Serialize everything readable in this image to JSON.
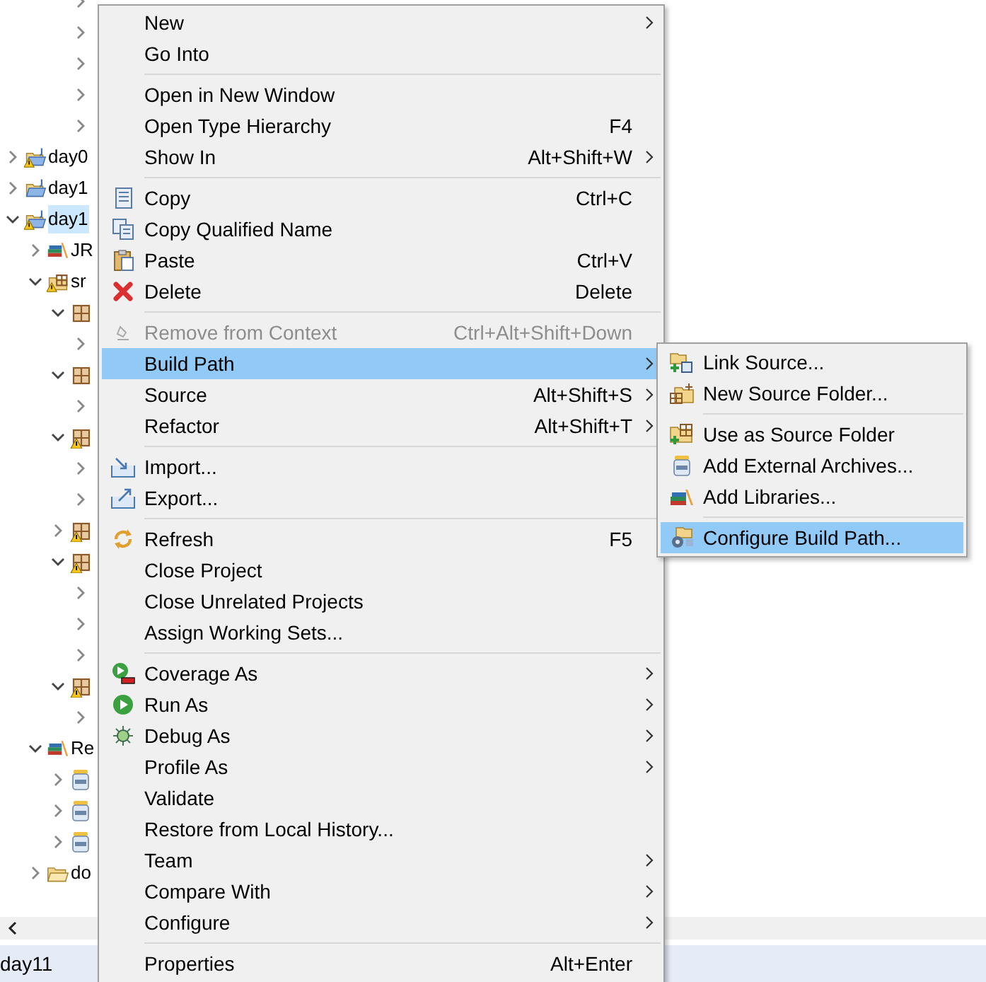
{
  "tree": {
    "items": [
      {
        "children": [
          {
            "children": [
              {
                "children": [
                  {
                    "kind": "file",
                    "expanded": false
                  },
                  {
                    "kind": "file",
                    "expanded": false
                  },
                  {
                    "kind": "file",
                    "expanded": false
                  },
                  {
                    "kind": "file",
                    "expanded": false
                  },
                  {
                    "kind": "file",
                    "expanded": false
                  }
                ]
              }
            ]
          }
        ]
      },
      {
        "kind": "project",
        "label": "day0",
        "expanded": false,
        "warning": true,
        "selected": false
      },
      {
        "kind": "project",
        "label": "day1",
        "expanded": false,
        "warning": false,
        "selected": false
      },
      {
        "kind": "project",
        "label": "day1",
        "expanded": true,
        "warning": true,
        "selected": true,
        "children": [
          {
            "kind": "library",
            "label": "JR",
            "expanded": false,
            "selected": false
          },
          {
            "kind": "source-folder",
            "label": "sr",
            "expanded": true,
            "warning": true,
            "selected": false,
            "children": [
              {
                "kind": "package",
                "expanded": true,
                "warning": false,
                "children": [
                  {
                    "kind": "file",
                    "expanded": false
                  }
                ]
              },
              {
                "kind": "package",
                "expanded": true,
                "warning": false,
                "children": [
                  {
                    "kind": "file",
                    "expanded": false
                  }
                ]
              },
              {
                "kind": "package",
                "expanded": true,
                "warning": true,
                "children": [
                  {
                    "kind": "file",
                    "expanded": false
                  },
                  {
                    "kind": "file",
                    "expanded": false
                  }
                ]
              },
              {
                "kind": "package",
                "expanded": false,
                "warning": true
              },
              {
                "kind": "package",
                "expanded": true,
                "warning": true,
                "children": [
                  {
                    "kind": "file",
                    "expanded": false
                  },
                  {
                    "kind": "file",
                    "expanded": false
                  },
                  {
                    "kind": "file",
                    "expanded": false
                  }
                ]
              },
              {
                "kind": "package",
                "expanded": true,
                "warning": true,
                "children": [
                  {
                    "kind": "file",
                    "expanded": false
                  }
                ]
              }
            ]
          },
          {
            "kind": "library",
            "label": "Re",
            "expanded": true,
            "selected": false,
            "children": [
              {
                "kind": "jar",
                "expanded": false
              },
              {
                "kind": "jar",
                "expanded": false
              },
              {
                "kind": "jar",
                "expanded": false
              }
            ]
          },
          {
            "kind": "folder",
            "label": "do",
            "expanded": false,
            "selected": false
          }
        ]
      }
    ]
  },
  "status_bar": {
    "text": "day11"
  },
  "context_menu": {
    "items": [
      {
        "kind": "plain",
        "label": "New",
        "submenu": true,
        "disabled": false,
        "selected": false
      },
      {
        "kind": "plain",
        "label": "Go Into",
        "submenu": false,
        "disabled": false,
        "selected": false
      },
      {
        "kind": "separator"
      },
      {
        "kind": "plain",
        "label": "Open in New Window",
        "submenu": false,
        "disabled": false,
        "selected": false
      },
      {
        "kind": "plain",
        "label": "Open Type Hierarchy",
        "shortcut": "F4",
        "submenu": false,
        "disabled": false,
        "selected": false
      },
      {
        "kind": "plain",
        "label": "Show In",
        "shortcut": "Alt+Shift+W",
        "submenu": true,
        "disabled": false,
        "selected": false
      },
      {
        "kind": "separator"
      },
      {
        "kind": "copy",
        "label": "Copy",
        "shortcut": "Ctrl+C",
        "submenu": false,
        "disabled": false,
        "selected": false
      },
      {
        "kind": "copy-name",
        "label": "Copy Qualified Name",
        "submenu": false,
        "disabled": false,
        "selected": false
      },
      {
        "kind": "paste",
        "label": "Paste",
        "shortcut": "Ctrl+V",
        "submenu": false,
        "disabled": false,
        "selected": false
      },
      {
        "kind": "delete",
        "label": "Delete",
        "shortcut": "Delete",
        "submenu": false,
        "disabled": false,
        "selected": false
      },
      {
        "kind": "separator"
      },
      {
        "kind": "remove",
        "label": "Remove from Context",
        "shortcut": "Ctrl+Alt+Shift+Down",
        "submenu": false,
        "disabled": true,
        "selected": false
      },
      {
        "kind": "plain",
        "label": "Build Path",
        "submenu": true,
        "disabled": false,
        "selected": true
      },
      {
        "kind": "plain",
        "label": "Source",
        "shortcut": "Alt+Shift+S",
        "submenu": true,
        "disabled": false,
        "selected": false
      },
      {
        "kind": "plain",
        "label": "Refactor",
        "shortcut": "Alt+Shift+T",
        "submenu": true,
        "disabled": false,
        "selected": false
      },
      {
        "kind": "separator"
      },
      {
        "kind": "import",
        "label": "Import...",
        "submenu": false,
        "disabled": false,
        "selected": false
      },
      {
        "kind": "export",
        "label": "Export...",
        "submenu": false,
        "disabled": false,
        "selected": false
      },
      {
        "kind": "separator"
      },
      {
        "kind": "refresh",
        "label": "Refresh",
        "shortcut": "F5",
        "submenu": false,
        "disabled": false,
        "selected": false
      },
      {
        "kind": "plain",
        "label": "Close Project",
        "submenu": false,
        "disabled": false,
        "selected": false
      },
      {
        "kind": "plain",
        "label": "Close Unrelated Projects",
        "submenu": false,
        "disabled": false,
        "selected": false
      },
      {
        "kind": "plain",
        "label": "Assign Working Sets...",
        "submenu": false,
        "disabled": false,
        "selected": false
      },
      {
        "kind": "separator"
      },
      {
        "kind": "coverage",
        "label": "Coverage As",
        "submenu": true,
        "disabled": false,
        "selected": false
      },
      {
        "kind": "run",
        "label": "Run As",
        "submenu": true,
        "disabled": false,
        "selected": false
      },
      {
        "kind": "debug",
        "label": "Debug As",
        "submenu": true,
        "disabled": false,
        "selected": false
      },
      {
        "kind": "plain",
        "label": "Profile As",
        "submenu": true,
        "disabled": false,
        "selected": false
      },
      {
        "kind": "plain",
        "label": "Validate",
        "submenu": false,
        "disabled": false,
        "selected": false
      },
      {
        "kind": "plain",
        "label": "Restore from Local History...",
        "submenu": false,
        "disabled": false,
        "selected": false
      },
      {
        "kind": "plain",
        "label": "Team",
        "submenu": true,
        "disabled": false,
        "selected": false
      },
      {
        "kind": "plain",
        "label": "Compare With",
        "submenu": true,
        "disabled": false,
        "selected": false
      },
      {
        "kind": "plain",
        "label": "Configure",
        "submenu": true,
        "disabled": false,
        "selected": false
      },
      {
        "kind": "separator"
      },
      {
        "kind": "plain",
        "label": "Properties",
        "shortcut": "Alt+Enter",
        "submenu": false,
        "disabled": false,
        "selected": false
      }
    ]
  },
  "submenu": {
    "items": [
      {
        "kind": "link-source",
        "label": "Link Source...",
        "selected": false
      },
      {
        "kind": "new-source-folder",
        "label": "New Source Folder...",
        "selected": false
      },
      {
        "kind": "separator"
      },
      {
        "kind": "use-source-folder",
        "label": "Use as Source Folder",
        "selected": false
      },
      {
        "kind": "jar",
        "label": "Add External Archives...",
        "selected": false
      },
      {
        "kind": "library",
        "label": "Add Libraries...",
        "selected": false
      },
      {
        "kind": "separator"
      },
      {
        "kind": "configure",
        "label": "Configure Build Path...",
        "selected": true
      }
    ]
  }
}
